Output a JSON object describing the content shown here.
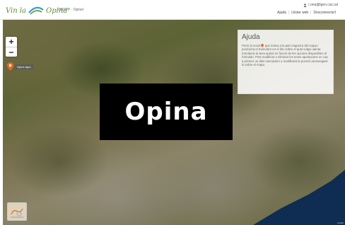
{
  "header": {
    "logo": {
      "text_left": "Vin la",
      "text_right": "Opina",
      "brand_color": "#5d8f3a",
      "swoosh_color": "#3a9fd5"
    },
    "app_name": "OBSPP · Opinel",
    "user": {
      "icon": "user-icon",
      "email": "r.ona@lgen.cat.cat"
    },
    "nav": [
      {
        "label": "Ajuda"
      },
      {
        "label": "Llistar web"
      },
      {
        "label": "Desconnecta't"
      }
    ]
  },
  "map": {
    "zoom_in_label": "+",
    "zoom_out_label": "−",
    "marker": {
      "icon": "map-pin-icon",
      "color": "#e8682a",
      "label": "Opine aquí"
    },
    "layer_button_icon": "layers-icon",
    "sea_color": "#0f2d52",
    "attribution": "Leaflet"
  },
  "help_panel": {
    "title": "Ajuda",
    "body_before_icon": "Prem la icona",
    "body_after_icon": "que indica a la part esquerra del mapa i posiciona el marcador en el lloc sobre el qual vulgui opinar. Introdueix la teva opinió en funció de les opcions disponibles al formulari. Pots modificar o eliminar les teves aportacions un cop a prémer un dels marcadors o modificant la posició arrossegant-lo sobre el mapa."
  },
  "banner": {
    "text": "Opina",
    "background": "#000000"
  }
}
